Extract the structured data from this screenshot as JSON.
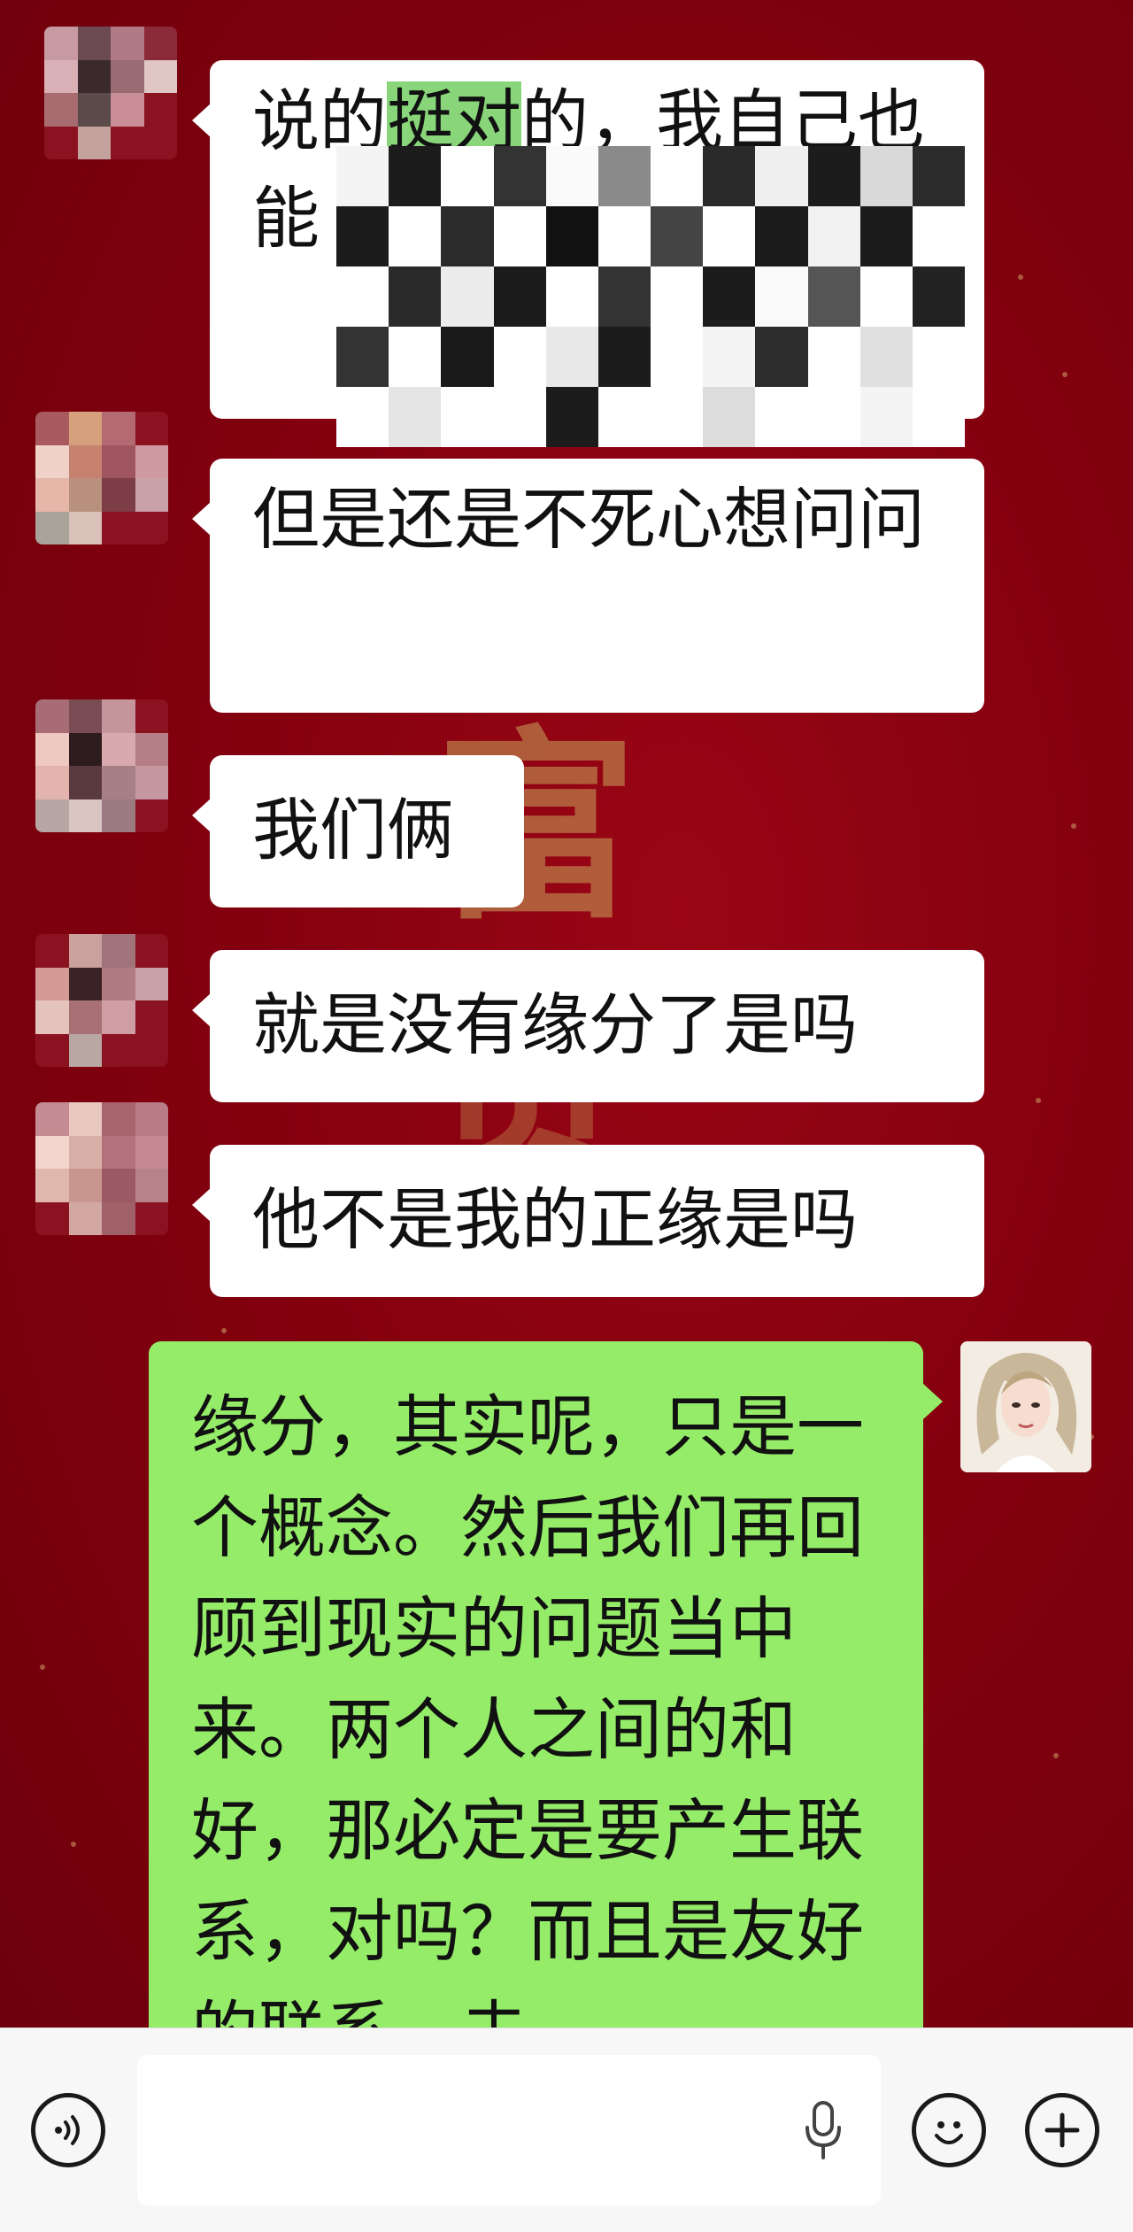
{
  "messages": [
    {
      "side": "left",
      "text_before": "说的",
      "highlight": "挺对",
      "text_after": "的，我自己也",
      "line3": "能",
      "obscured": true
    },
    {
      "side": "left",
      "text": "但是还是不死心想问问"
    },
    {
      "side": "left",
      "text": "我们俩"
    },
    {
      "side": "left",
      "text": "就是没有缘分了是吗"
    },
    {
      "side": "left",
      "text": "他不是我的正缘是吗"
    },
    {
      "side": "right",
      "text": "缘分，其实呢，只是一个概念。然后我们再回顾到现实的问题当中来。两个人之间的和好，那必定是要产生联系，对吗？而且是友好的联系，去"
    }
  ],
  "input_bar": {
    "input_value": "",
    "icons": {
      "voice": "voice-toggle-icon",
      "mic": "microphone-icon",
      "emoji": "emoji-icon",
      "more": "plus-icon"
    }
  },
  "colors": {
    "background": "#84000f",
    "incoming_bubble": "#ffffff",
    "outgoing_bubble": "#95ec69",
    "highlight": "#88d57a",
    "input_bar": "#f7f7f7"
  }
}
